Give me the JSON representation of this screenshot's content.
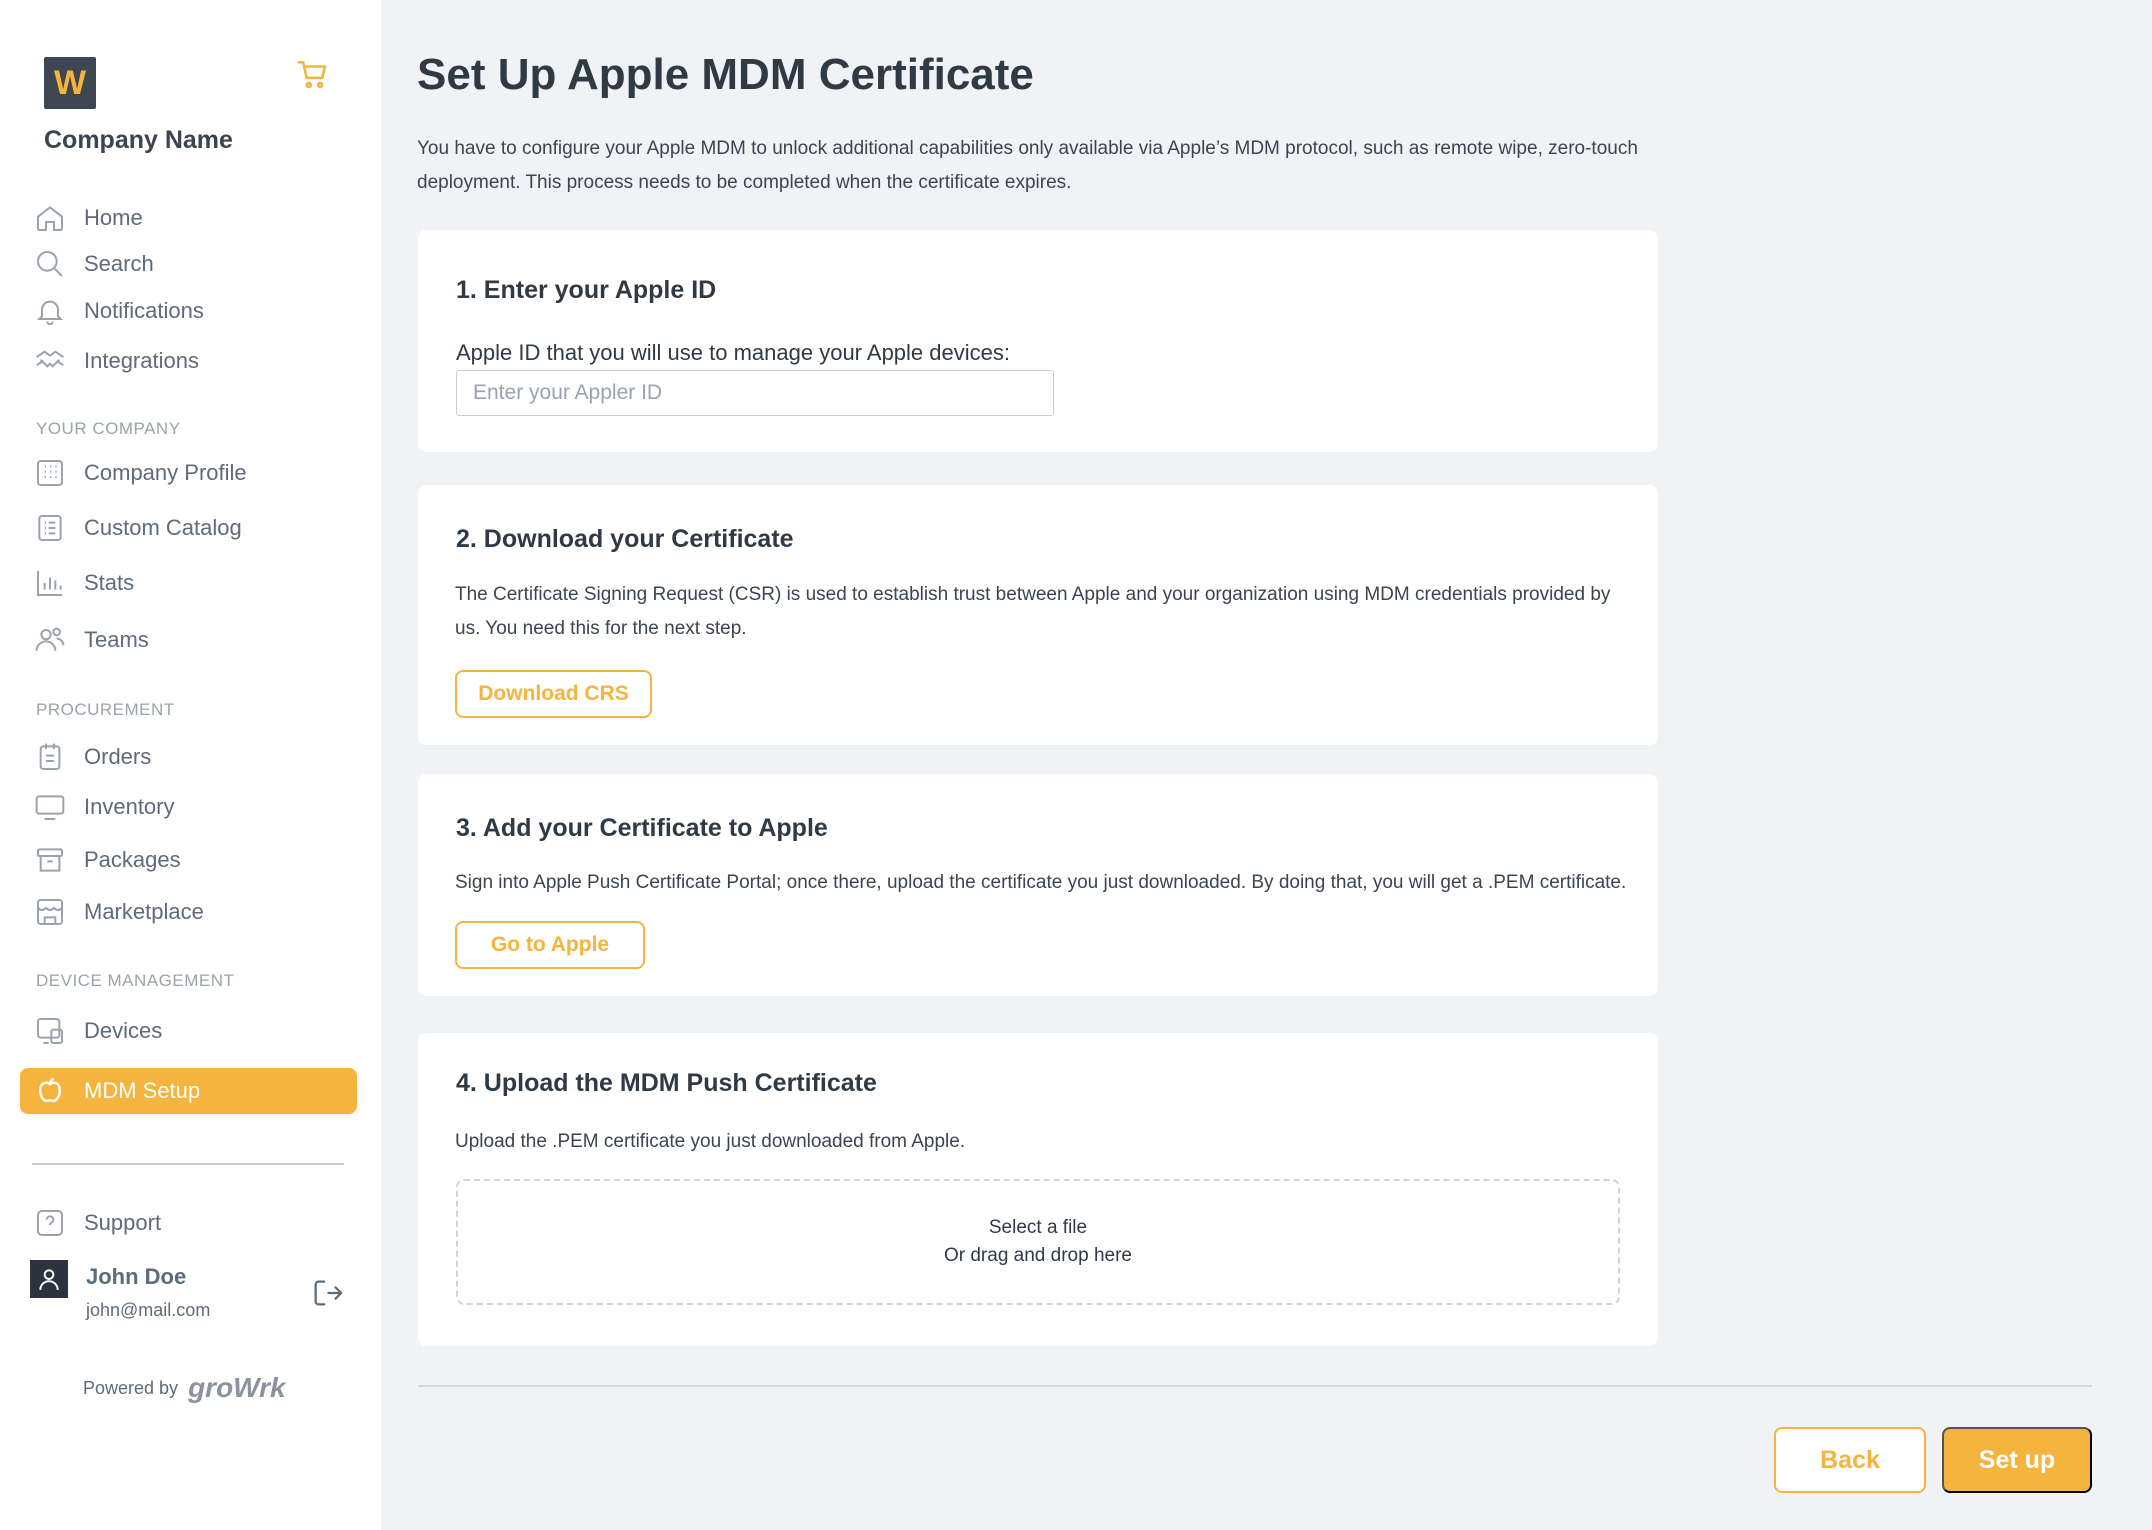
{
  "sidebar": {
    "logo_letter": "W",
    "company_name": "Company Name",
    "nav_main": [
      {
        "label": "Home",
        "icon": "home-icon"
      },
      {
        "label": "Search",
        "icon": "search-icon"
      },
      {
        "label": "Notifications",
        "icon": "bell-icon"
      },
      {
        "label": "Integrations",
        "icon": "handshake-icon"
      }
    ],
    "section_company": "YOUR COMPANY",
    "nav_company": [
      {
        "label": "Company Profile",
        "icon": "building-icon"
      },
      {
        "label": "Custom Catalog",
        "icon": "catalog-icon"
      },
      {
        "label": "Stats",
        "icon": "chart-icon"
      },
      {
        "label": "Teams",
        "icon": "people-icon"
      }
    ],
    "section_procurement": "PROCUREMENT",
    "nav_procurement": [
      {
        "label": "Orders",
        "icon": "clipboard-icon"
      },
      {
        "label": "Inventory",
        "icon": "monitor-icon"
      },
      {
        "label": "Packages",
        "icon": "archive-icon"
      },
      {
        "label": "Marketplace",
        "icon": "store-icon"
      }
    ],
    "section_device": "DEVICE MANAGEMENT",
    "nav_device": [
      {
        "label": "Devices",
        "icon": "devices-icon"
      },
      {
        "label": "MDM Setup",
        "icon": "apple-icon",
        "active": true
      }
    ],
    "support_label": "Support",
    "user": {
      "name": "John Doe",
      "email": "john@mail.com"
    },
    "powered_by": "Powered by",
    "brand": "groWrk"
  },
  "main": {
    "title": "Set Up Apple MDM Certificate",
    "description": "You have to configure your Apple MDM to unlock additional capabilities only available via Apple’s MDM protocol, such as remote wipe, zero-touch deployment. This process needs to be completed when the certificate expires.",
    "step1": {
      "title": "1. Enter your Apple ID",
      "field_label": "Apple ID that you will use to manage your Apple devices:",
      "placeholder": "Enter your Appler ID"
    },
    "step2": {
      "title": "2. Download your Certificate",
      "text": "The Certificate Signing Request (CSR) is used to establish trust between Apple and your organization using MDM credentials provided by us. You need this for the next step.",
      "button": "Download CRS"
    },
    "step3": {
      "title": "3. Add your Certificate to Apple",
      "text": "Sign into Apple Push Certificate Portal; once there, upload the certificate you just downloaded. By doing that, you will get a .PEM certificate.",
      "button": "Go to Apple"
    },
    "step4": {
      "title": "4. Upload the MDM Push Certificate",
      "text": "Upload the .PEM certificate you just downloaded from Apple.",
      "dropzone_line1": "Select a file",
      "dropzone_line2": "Or drag and drop here"
    },
    "back_label": "Back",
    "setup_label": "Set up"
  }
}
